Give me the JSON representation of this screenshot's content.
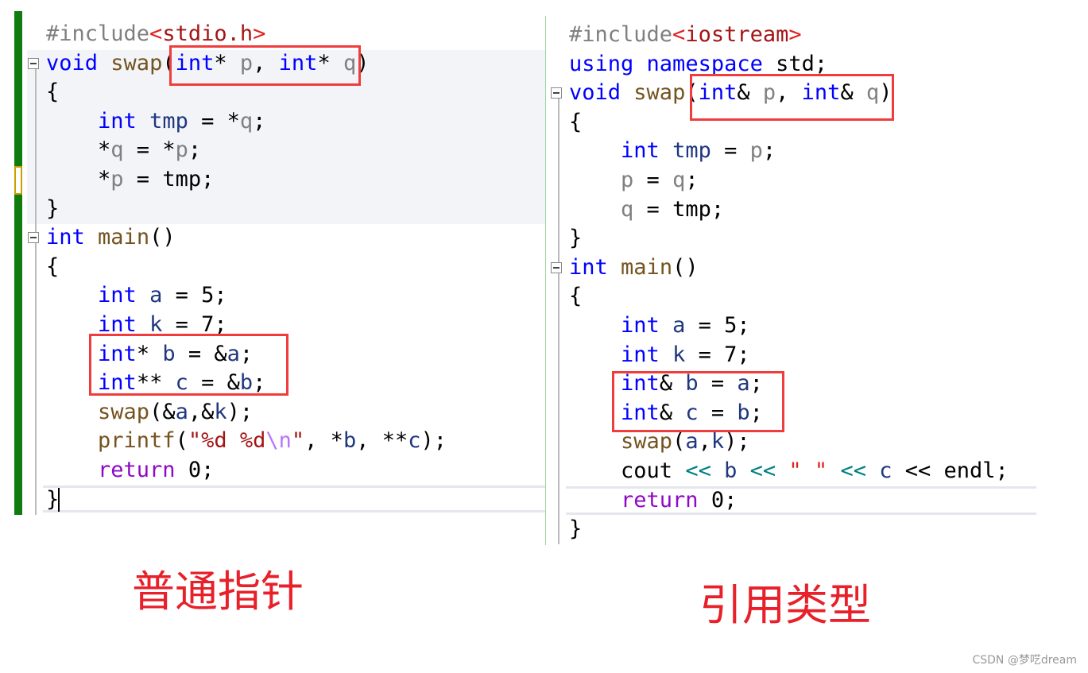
{
  "left": {
    "lines": [
      [
        [
          "#include",
          "inc"
        ],
        [
          "<",
          "ang"
        ],
        [
          "stdio.h",
          "st"
        ],
        [
          ">",
          "ang"
        ]
      ],
      [
        [
          "void",
          "kw"
        ],
        [
          " ",
          "pl"
        ],
        [
          "swap",
          "fn"
        ],
        [
          "(",
          "pl"
        ],
        [
          "int",
          "kw"
        ],
        [
          "* ",
          "pl"
        ],
        [
          "p",
          "pa"
        ],
        [
          ", ",
          "pl"
        ],
        [
          "int",
          "kw"
        ],
        [
          "* ",
          "pl"
        ],
        [
          "q",
          "pa"
        ],
        [
          ")",
          "pl"
        ]
      ],
      [
        [
          "{",
          "pl"
        ]
      ],
      [
        [
          "    ",
          "pl"
        ],
        [
          "int",
          "kw"
        ],
        [
          " ",
          "pl"
        ],
        [
          "tmp",
          "lv"
        ],
        [
          " = *",
          "pl"
        ],
        [
          "q",
          "pa"
        ],
        [
          ";",
          "pl"
        ]
      ],
      [
        [
          "    *",
          "pl"
        ],
        [
          "q",
          "pa"
        ],
        [
          " = *",
          "pl"
        ],
        [
          "p",
          "pa"
        ],
        [
          ";",
          "pl"
        ]
      ],
      [
        [
          "    *",
          "pl"
        ],
        [
          "p",
          "pa"
        ],
        [
          " = tmp;",
          "pl"
        ]
      ],
      [
        [
          "}",
          "pl"
        ]
      ],
      [
        [
          "int",
          "kw"
        ],
        [
          " ",
          "pl"
        ],
        [
          "main",
          "fn"
        ],
        [
          "()",
          "pl"
        ]
      ],
      [
        [
          "{",
          "pl"
        ]
      ],
      [
        [
          "    ",
          "pl"
        ],
        [
          "int",
          "kw"
        ],
        [
          " ",
          "pl"
        ],
        [
          "a",
          "lv"
        ],
        [
          " = 5;",
          "pl"
        ]
      ],
      [
        [
          "    ",
          "pl"
        ],
        [
          "int",
          "kw"
        ],
        [
          " ",
          "pl"
        ],
        [
          "k",
          "lv"
        ],
        [
          " = 7;",
          "pl"
        ]
      ],
      [
        [
          "    ",
          "pl"
        ],
        [
          "int",
          "kw"
        ],
        [
          "* ",
          "pl"
        ],
        [
          "b",
          "lv"
        ],
        [
          " = &",
          "pl"
        ],
        [
          "a",
          "lv"
        ],
        [
          ";",
          "pl"
        ]
      ],
      [
        [
          "    ",
          "pl"
        ],
        [
          "int",
          "kw"
        ],
        [
          "** ",
          "pl"
        ],
        [
          "c",
          "lv"
        ],
        [
          " = &",
          "pl"
        ],
        [
          "b",
          "lv"
        ],
        [
          ";",
          "pl"
        ]
      ],
      [
        [
          "    ",
          "pl"
        ],
        [
          "swap",
          "fn"
        ],
        [
          "(&",
          "pl"
        ],
        [
          "a",
          "lv"
        ],
        [
          ",&",
          "pl"
        ],
        [
          "k",
          "lv"
        ],
        [
          ");",
          "pl"
        ]
      ],
      [
        [
          "    ",
          "pl"
        ],
        [
          "printf",
          "fn"
        ],
        [
          "(",
          "pl"
        ],
        [
          "\"%d %d",
          "st"
        ],
        [
          "\\n",
          "esc"
        ],
        [
          "\"",
          "st"
        ],
        [
          ", *",
          "pl"
        ],
        [
          "b",
          "lv"
        ],
        [
          ", **",
          "pl"
        ],
        [
          "c",
          "lv"
        ],
        [
          ");",
          "pl"
        ]
      ],
      [
        [
          "    ",
          "pl"
        ],
        [
          "return",
          "ret"
        ],
        [
          " 0;",
          "pl"
        ]
      ],
      [
        [
          "}",
          "pl"
        ]
      ]
    ]
  },
  "right": {
    "lines": [
      [
        [
          "#include",
          "inc"
        ],
        [
          "<",
          "ang"
        ],
        [
          "iostream",
          "st"
        ],
        [
          ">",
          "ang"
        ]
      ],
      [
        [
          "using",
          "kw"
        ],
        [
          " ",
          "pl"
        ],
        [
          "namespace",
          "kw"
        ],
        [
          " std;",
          "pl"
        ]
      ],
      [
        [
          "void",
          "kw"
        ],
        [
          " ",
          "pl"
        ],
        [
          "swap",
          "fn"
        ],
        [
          "(",
          "pl"
        ],
        [
          "int",
          "kw"
        ],
        [
          "& ",
          "pl"
        ],
        [
          "p",
          "pa"
        ],
        [
          ", ",
          "pl"
        ],
        [
          "int",
          "kw"
        ],
        [
          "& ",
          "pl"
        ],
        [
          "q",
          "pa"
        ],
        [
          ")",
          "pl"
        ]
      ],
      [
        [
          "{",
          "pl"
        ]
      ],
      [
        [
          "    ",
          "pl"
        ],
        [
          "int",
          "kw"
        ],
        [
          " ",
          "pl"
        ],
        [
          "tmp",
          "lv"
        ],
        [
          " = ",
          "pl"
        ],
        [
          "p",
          "pa"
        ],
        [
          ";",
          "pl"
        ]
      ],
      [
        [
          "    ",
          "pl"
        ],
        [
          "p",
          "pa"
        ],
        [
          " = ",
          "pl"
        ],
        [
          "q",
          "pa"
        ],
        [
          ";",
          "pl"
        ]
      ],
      [
        [
          "    ",
          "pl"
        ],
        [
          "q",
          "pa"
        ],
        [
          " = tmp;",
          "pl"
        ]
      ],
      [
        [
          "}",
          "pl"
        ]
      ],
      [
        [
          "int",
          "kw"
        ],
        [
          " ",
          "pl"
        ],
        [
          "main",
          "fn"
        ],
        [
          "()",
          "pl"
        ]
      ],
      [
        [
          "{",
          "pl"
        ]
      ],
      [
        [
          "    ",
          "pl"
        ],
        [
          "int",
          "kw"
        ],
        [
          " ",
          "pl"
        ],
        [
          "a",
          "lv"
        ],
        [
          " = 5;",
          "pl"
        ]
      ],
      [
        [
          "    ",
          "pl"
        ],
        [
          "int",
          "kw"
        ],
        [
          " ",
          "pl"
        ],
        [
          "k",
          "lv"
        ],
        [
          " = 7;",
          "pl"
        ]
      ],
      [
        [
          "    ",
          "pl"
        ],
        [
          "int",
          "kw"
        ],
        [
          "& ",
          "pl"
        ],
        [
          "b",
          "lv"
        ],
        [
          " = ",
          "pl"
        ],
        [
          "a",
          "lv"
        ],
        [
          ";",
          "pl"
        ]
      ],
      [
        [
          "    ",
          "pl"
        ],
        [
          "int",
          "kw"
        ],
        [
          "& ",
          "pl"
        ],
        [
          "c",
          "lv"
        ],
        [
          " = ",
          "pl"
        ],
        [
          "b",
          "lv"
        ],
        [
          ";",
          "pl"
        ]
      ],
      [
        [
          "    ",
          "pl"
        ],
        [
          "swap",
          "fn"
        ],
        [
          "(",
          "pl"
        ],
        [
          "a",
          "lv"
        ],
        [
          ",",
          "pl"
        ],
        [
          "k",
          "lv"
        ],
        [
          ");",
          "pl"
        ]
      ],
      [
        [
          "    cout ",
          "pl"
        ],
        [
          "<<",
          "op"
        ],
        [
          " ",
          "pl"
        ],
        [
          "b",
          "lv"
        ],
        [
          " ",
          "pl"
        ],
        [
          "<<",
          "op"
        ],
        [
          " ",
          "pl"
        ],
        [
          "\" \"",
          "ang"
        ],
        [
          " ",
          "pl"
        ],
        [
          "<<",
          "op"
        ],
        [
          " ",
          "pl"
        ],
        [
          "c",
          "lv"
        ],
        [
          " << endl;",
          "pl"
        ]
      ],
      [
        [
          "    ",
          "pl"
        ],
        [
          "return",
          "ret"
        ],
        [
          " 0;",
          "pl"
        ]
      ],
      [
        [
          "}",
          "pl"
        ]
      ]
    ]
  },
  "captions": {
    "left": "普通指针",
    "right": "引用类型"
  },
  "watermark": "CSDN @梦呓dream",
  "colors": {
    "highlight_box": "#f03c3c",
    "caption": "#e8202a",
    "change_bar": "#107c10"
  }
}
